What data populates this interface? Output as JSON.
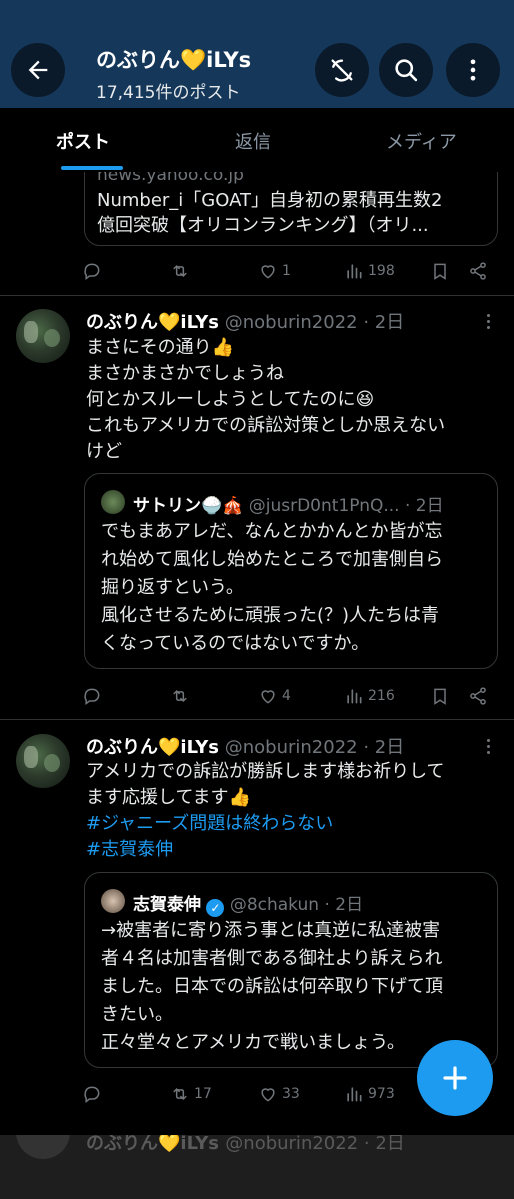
{
  "header": {
    "title": "のぶりん💛iLYs",
    "post_count": "17,415件のポスト"
  },
  "tabs": [
    {
      "label": "ポスト",
      "active": true
    },
    {
      "label": "返信",
      "active": false
    },
    {
      "label": "メディア",
      "active": false
    }
  ],
  "posts": [
    {
      "quote": {
        "source": "news.yahoo.co.jp",
        "lines": [
          "Number_i「GOAT」自身初の累積再生数2",
          "億回突破【オリコンランキング】（オリ..."
        ]
      },
      "stats": {
        "replies": "",
        "reposts": "",
        "likes": "1",
        "views": "198"
      }
    },
    {
      "author": "のぶりん💛iLYs",
      "handle": "@noburin2022 · 2日",
      "lines": [
        "まさにその通り👍",
        "まさかまさかでしょうね",
        "何とかスルーしようとしてたのに😆",
        "これもアメリカでの訴訟対策としか思えない",
        "けど"
      ],
      "quote": {
        "author": "サトリン🍚🎪",
        "handle": "@jusrD0nt1PnQ... · 2日",
        "lines": [
          "でもまあアレだ、なんとかかんとか皆が忘",
          "れ始めて風化し始めたところで加害側自ら",
          "掘り返すという。",
          "風化させるために頑張った(？)人たちは青",
          "くなっているのではないですか。"
        ]
      },
      "stats": {
        "replies": "",
        "reposts": "",
        "likes": "4",
        "views": "216"
      }
    },
    {
      "author": "のぶりん💛iLYs",
      "handle": "@noburin2022 · 2日",
      "lines": [
        "アメリカでの訴訟が勝訴します様お祈りして",
        "ます応援してます👍"
      ],
      "hashtags": [
        "#ジャニーズ問題は終わらない",
        "#志賀泰伸"
      ],
      "quote": {
        "author": "志賀泰伸",
        "handle": "@8chakun · 2日",
        "lines": [
          "→被害者に寄り添う事とは真逆に私達被害",
          "者４名は加害者側である御社より訴えられ",
          "ました。日本での訴訟は何卒取り下げて頂",
          "きたい。",
          "正々堂々とアメリカで戦いましょう。"
        ]
      },
      "stats": {
        "replies": "",
        "reposts": "17",
        "likes": "33",
        "views": "973"
      }
    }
  ],
  "next_post": {
    "author": "のぶりん💛iLYs",
    "handle": "@noburin2022 · 2日"
  },
  "colors": {
    "header_bg": "#15385a",
    "accent": "#1d9bf0",
    "background": "#000000"
  }
}
